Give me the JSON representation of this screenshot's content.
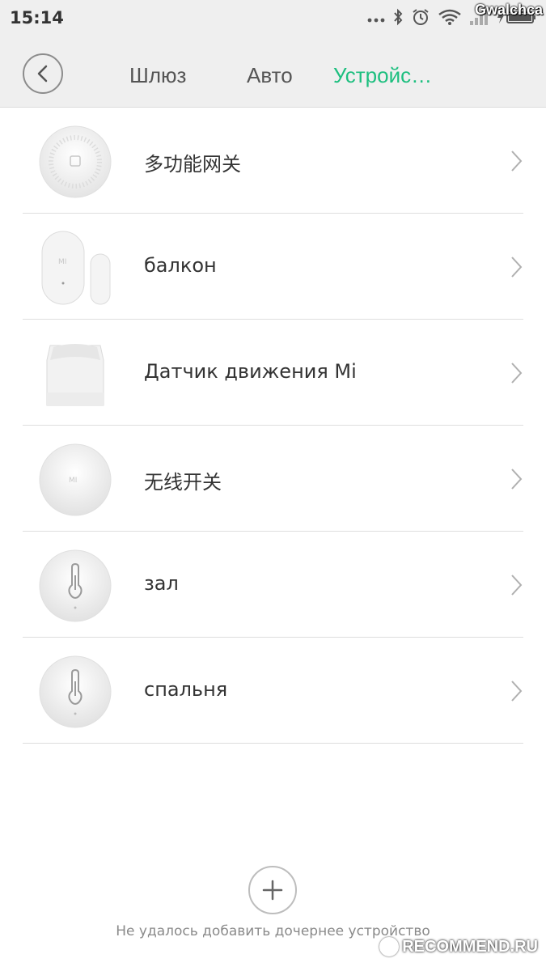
{
  "status_bar": {
    "time": "15:14",
    "icons": [
      "more-dots-icon",
      "bluetooth-icon",
      "alarm-icon",
      "wifi-icon",
      "signal-icon",
      "battery-icon"
    ]
  },
  "watermark_user": "Gwalchca",
  "header": {
    "back_icon": "chevron-left-icon",
    "tabs": [
      {
        "label": "Шлюз",
        "active": false
      },
      {
        "label": "Авто",
        "active": false
      },
      {
        "label": "Устройс…",
        "active": true
      }
    ],
    "active_color": "#1dbf7f"
  },
  "devices": [
    {
      "label": "多功能网关",
      "icon": "gateway-icon"
    },
    {
      "label": "балкон",
      "icon": "door-window-sensor-icon"
    },
    {
      "label": "Датчик движения Mi",
      "icon": "motion-sensor-icon"
    },
    {
      "label": "无线开关",
      "icon": "wireless-switch-icon"
    },
    {
      "label": "зал",
      "icon": "temperature-sensor-icon"
    },
    {
      "label": "спальня",
      "icon": "temperature-sensor-icon"
    }
  ],
  "add_device": {
    "icon": "plus-icon",
    "error_text": "Не удалось добавить дочернее устройство"
  },
  "watermark_site": "RECOMMEND.RU"
}
